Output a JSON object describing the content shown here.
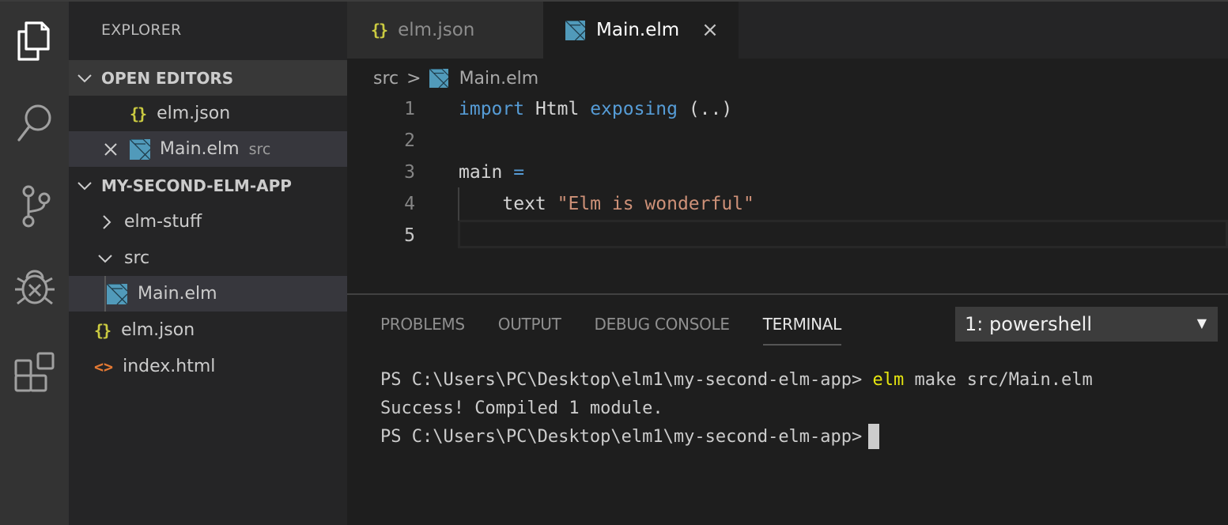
{
  "activity_bar": {
    "items": [
      {
        "name": "explorer",
        "icon": "files-icon",
        "active": true
      },
      {
        "name": "search",
        "icon": "search-icon",
        "active": false
      },
      {
        "name": "source-control",
        "icon": "source-control-icon",
        "active": false
      },
      {
        "name": "debug",
        "icon": "debug-icon",
        "active": false
      },
      {
        "name": "extensions",
        "icon": "extensions-icon",
        "active": false
      }
    ]
  },
  "sidebar": {
    "title": "EXPLORER",
    "open_editors": {
      "label": "OPEN EDITORS",
      "items": [
        {
          "name": "elm.json",
          "icon": "json-braces-icon",
          "description": ""
        },
        {
          "name": "Main.elm",
          "icon": "elm-icon",
          "description": "src",
          "active": true
        }
      ]
    },
    "project": {
      "label": "MY-SECOND-ELM-APP",
      "tree": [
        {
          "name": "elm-stuff",
          "type": "folder",
          "expanded": false
        },
        {
          "name": "src",
          "type": "folder",
          "expanded": true
        },
        {
          "name": "Main.elm",
          "type": "file",
          "icon": "elm-icon",
          "selected": true
        },
        {
          "name": "elm.json",
          "type": "file",
          "icon": "json-braces-icon"
        },
        {
          "name": "index.html",
          "type": "file",
          "icon": "html-icon"
        }
      ]
    }
  },
  "tabs": [
    {
      "label": "elm.json",
      "icon": "json-braces-icon",
      "active": false
    },
    {
      "label": "Main.elm",
      "icon": "elm-icon",
      "active": true,
      "close": "×"
    }
  ],
  "breadcrumb": {
    "folder": "src",
    "separator": ">",
    "file": "Main.elm"
  },
  "editor": {
    "lines": [
      {
        "number": "1",
        "tokens": [
          {
            "t": "import",
            "c": "kw"
          },
          {
            "t": " Html ",
            "c": "plain"
          },
          {
            "t": "exposing",
            "c": "kw"
          },
          {
            "t": " (..)",
            "c": "plain"
          }
        ]
      },
      {
        "number": "2",
        "tokens": []
      },
      {
        "number": "3",
        "tokens": [
          {
            "t": "main ",
            "c": "plain"
          },
          {
            "t": "=",
            "c": "kw"
          }
        ]
      },
      {
        "number": "4",
        "tokens": [
          {
            "t": "    text ",
            "c": "plain"
          },
          {
            "t": "\"Elm is wonderful\"",
            "c": "str"
          }
        ]
      },
      {
        "number": "5",
        "tokens": []
      }
    ],
    "current_line": 5
  },
  "panel": {
    "tabs": [
      "PROBLEMS",
      "OUTPUT",
      "DEBUG CONSOLE",
      "TERMINAL"
    ],
    "active_tab": "TERMINAL",
    "terminal_selector": {
      "value": "1: powershell",
      "arrow": "▼"
    },
    "terminal": {
      "line1_prompt": "PS C:\\Users\\PC\\Desktop\\elm1\\my-second-elm-app> ",
      "line1_cmd": "elm",
      "line1_args": " make src/Main.elm",
      "line2": "Success! Compiled 1 module.",
      "line3_prompt": "PS C:\\Users\\PC\\Desktop\\elm1\\my-second-elm-app>"
    }
  },
  "colors": {
    "keyword": "#569cd6",
    "string": "#ce9178",
    "json_icon": "#cbcb41",
    "html_icon": "#e37933",
    "elm_icon": "#519aba",
    "terminal_cmd": "#e5e510"
  }
}
